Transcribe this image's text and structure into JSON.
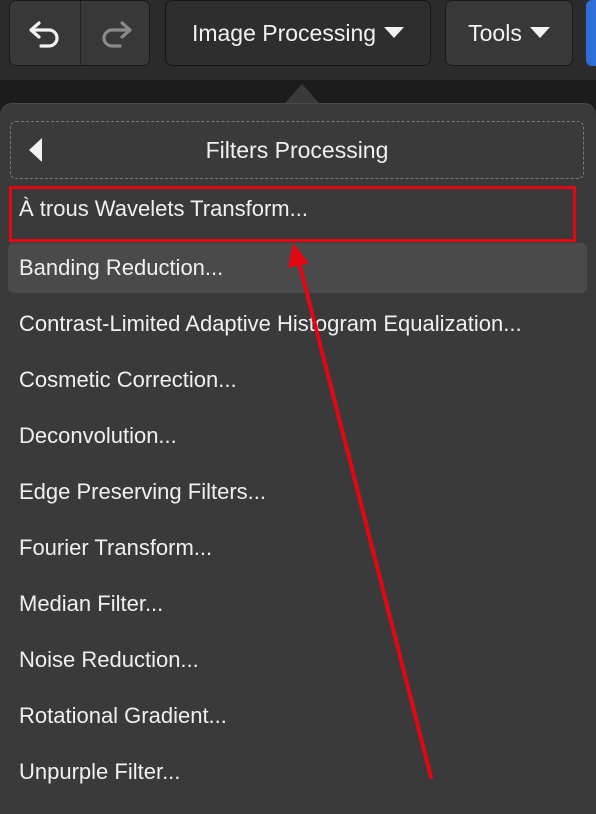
{
  "toolbar": {
    "undo_icon": "undo-arrow-icon",
    "redo_icon": "redo-arrow-icon",
    "image_processing_label": "Image Processing",
    "tools_label": "Tools"
  },
  "submenu": {
    "title": "Filters Processing",
    "back_icon": "chevron-left-icon",
    "items": [
      {
        "label": "À trous Wavelets Transform..."
      },
      {
        "label": "Banding Reduction..."
      },
      {
        "label": "Contrast-Limited Adaptive Histogram Equalization..."
      },
      {
        "label": "Cosmetic Correction..."
      },
      {
        "label": "Deconvolution..."
      },
      {
        "label": "Edge Preserving Filters..."
      },
      {
        "label": "Fourier Transform..."
      },
      {
        "label": "Median Filter..."
      },
      {
        "label": "Noise Reduction..."
      },
      {
        "label": "Rotational Gradient..."
      },
      {
        "label": "Unpurple Filter..."
      }
    ],
    "hovered_item": "Banding Reduction..."
  },
  "annotation": {
    "color": "#e30613",
    "highlighted_item": "À trous Wavelets Transform..."
  },
  "colors": {
    "toolbar_bg": "#2b2b2b",
    "button_bg": "#383838",
    "popover_bg": "#3a3a3a",
    "hover_bg": "#4a4a4a",
    "accent_blue": "#2d6fd6",
    "text": "#f0f0f0"
  }
}
